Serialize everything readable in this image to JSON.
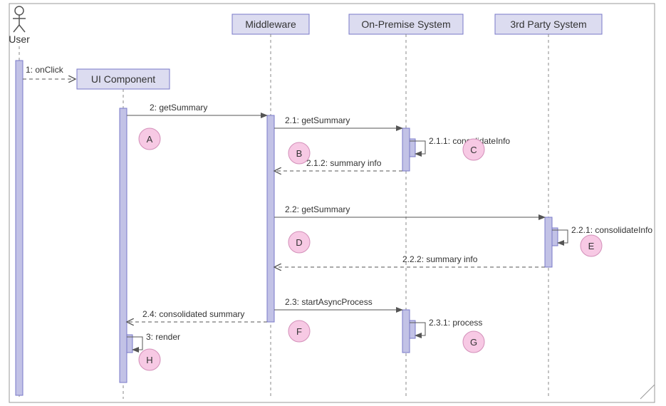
{
  "diagram_type": "sequence",
  "actor": {
    "name": "User"
  },
  "participants": {
    "ui": {
      "label": "UI Component"
    },
    "mw": {
      "label": "Middleware"
    },
    "op": {
      "label": "On-Premise System"
    },
    "tp": {
      "label": "3rd Party System"
    }
  },
  "messages": {
    "m1": "1: onClick",
    "m2": "2: getSummary",
    "m2_1": "2.1: getSummary",
    "m2_1_1": "2.1.1: consolidateInfo",
    "m2_1_2": "2.1.2: summary info",
    "m2_2": "2.2: getSummary",
    "m2_2_1": "2.2.1: consolidateInfo",
    "m2_2_2": "2.2.2: summary info",
    "m2_3": "2.3: startAsyncProcess",
    "m2_3_1": "2.3.1: process",
    "m2_4": "2.4: consolidated summary",
    "m3": "3: render"
  },
  "notes": {
    "A": "A",
    "B": "B",
    "C": "C",
    "D": "D",
    "E": "E",
    "F": "F",
    "G": "G",
    "H": "H"
  }
}
